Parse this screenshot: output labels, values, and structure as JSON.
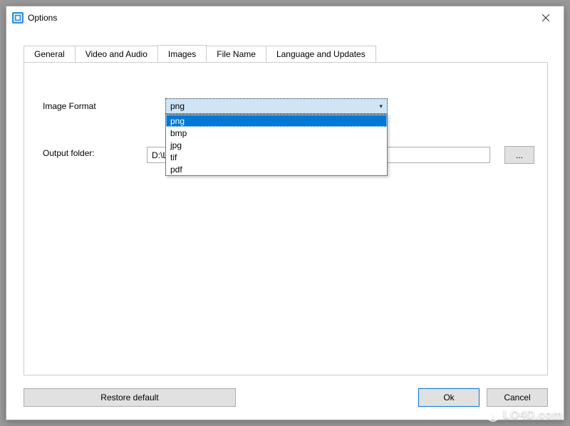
{
  "window": {
    "title": "Options"
  },
  "tabs": [
    {
      "label": "General"
    },
    {
      "label": "Video and Audio"
    },
    {
      "label": "Images"
    },
    {
      "label": "File Name"
    },
    {
      "label": "Language and Updates"
    }
  ],
  "fields": {
    "image_format": {
      "label": "Image Format",
      "selected": "png",
      "options": [
        "png",
        "bmp",
        "jpg",
        "tif",
        "pdf"
      ]
    },
    "output_folder": {
      "label": "Output folder:",
      "value": "D:\\LO"
    },
    "browse_label": "..."
  },
  "buttons": {
    "restore": "Restore default",
    "ok": "Ok",
    "cancel": "Cancel"
  },
  "watermark": "LO4D.com"
}
